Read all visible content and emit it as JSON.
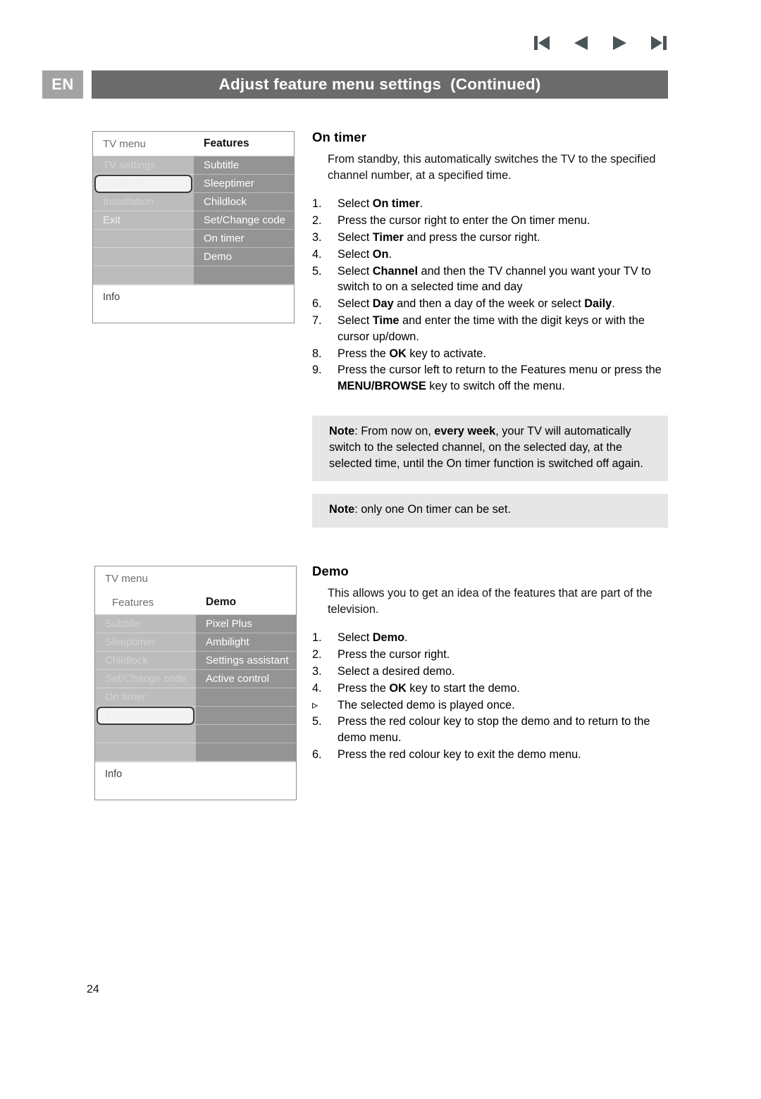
{
  "header": {
    "language_badge": "EN",
    "title": "Adjust feature menu settings  (Continued)"
  },
  "nav": {
    "first_label": "first-page",
    "prev_label": "previous-page",
    "next_label": "next-page",
    "last_label": "last-page",
    "icon_color": "#4a5557"
  },
  "page_number": "24",
  "colors": {
    "header_bar": "#6b6b6b",
    "badge": "#a3a3a3",
    "menu_left_column": "#bcbcbc",
    "menu_right_column": "#949494",
    "note_background": "#e6e6e6"
  },
  "tv_menu_1": {
    "header_left": "TV menu",
    "header_right": "Features",
    "left_column": [
      {
        "label": "TV settings",
        "state": "dim"
      },
      {
        "label": "Features",
        "state": "selected"
      },
      {
        "label": "Installation",
        "state": "dim"
      },
      {
        "label": "Exit",
        "state": "normal"
      },
      {
        "label": "",
        "state": "empty"
      },
      {
        "label": "",
        "state": "empty"
      },
      {
        "label": "",
        "state": "empty"
      }
    ],
    "right_column": [
      {
        "label": "Subtitle",
        "state": "normal"
      },
      {
        "label": "Sleeptimer",
        "state": "normal"
      },
      {
        "label": "Childlock",
        "state": "normal"
      },
      {
        "label": "Set/Change code",
        "state": "normal"
      },
      {
        "label": "On timer",
        "state": "normal"
      },
      {
        "label": "Demo",
        "state": "normal"
      },
      {
        "label": "",
        "state": "empty"
      }
    ],
    "footer": "Info"
  },
  "tv_menu_2": {
    "header_top": "TV menu",
    "header_left": "Features",
    "header_right": "Demo",
    "left_column": [
      {
        "label": "Subtitle",
        "state": "dim"
      },
      {
        "label": "Sleeptimer",
        "state": "dim"
      },
      {
        "label": "Childlock",
        "state": "dim"
      },
      {
        "label": "Set/Change code",
        "state": "dim"
      },
      {
        "label": "On timer",
        "state": "dim"
      },
      {
        "label": "Demo",
        "state": "selected"
      },
      {
        "label": "",
        "state": "empty"
      },
      {
        "label": "",
        "state": "empty"
      }
    ],
    "right_column": [
      {
        "label": "Pixel Plus",
        "state": "normal"
      },
      {
        "label": "Ambilight",
        "state": "normal"
      },
      {
        "label": "Settings assistant",
        "state": "normal"
      },
      {
        "label": "Active control",
        "state": "normal"
      },
      {
        "label": "",
        "state": "empty"
      },
      {
        "label": "",
        "state": "empty"
      },
      {
        "label": "",
        "state": "empty"
      },
      {
        "label": "",
        "state": "empty"
      }
    ],
    "footer": "Info"
  },
  "on_timer": {
    "title": "On timer",
    "intro": "From standby, this automatically switches the TV to the specified channel number, at a specified time.",
    "steps": [
      {
        "num": "1.",
        "html": "Select <span class=\"b\">On timer</span>."
      },
      {
        "num": "2.",
        "html": "Press the cursor right to enter the On timer menu."
      },
      {
        "num": "3.",
        "html": "Select <span class=\"b\">Timer</span> and press the cursor right."
      },
      {
        "num": "4.",
        "html": "Select <span class=\"b\">On</span>."
      },
      {
        "num": "5.",
        "html": "Select <span class=\"b\">Channel</span> and then the TV channel you want your TV to switch to on a selected time and day"
      },
      {
        "num": "6.",
        "html": "Select <span class=\"b\">Day</span> and then a day of the week or select <span class=\"b\">Daily</span>."
      },
      {
        "num": "7.",
        "html": "Select <span class=\"b\">Time</span> and enter the time with the digit keys or with the cursor up/down."
      },
      {
        "num": "8.",
        "html": "Press the <span class=\"b\">OK</span> key to activate."
      },
      {
        "num": "9.",
        "html": "Press the cursor left to return to the Features menu or press the <span class=\"b\">MENU/BROWSE</span> key to switch off the menu."
      }
    ],
    "note_1_html": "<span class=\"b\">Note</span>: From now on, <span class=\"b\">every week</span>, your TV will automatically switch to the selected channel, on the selected day, at the selected time, until the On timer function is switched off again.",
    "note_2_html": "<span class=\"b\">Note</span>: only one On timer can be set."
  },
  "demo": {
    "title": "Demo",
    "intro": "This allows you to get an idea of the features that are part of the television.",
    "steps": [
      {
        "num": "1.",
        "html": "Select <span class=\"b\">Demo</span>."
      },
      {
        "num": "2.",
        "html": "Press the cursor right."
      },
      {
        "num": "3.",
        "html": "Select a desired demo."
      },
      {
        "num": "4.",
        "html": "Press the <span class=\"b\">OK</span> key to start the demo."
      },
      {
        "num": "▹",
        "html": "The selected demo is played once."
      },
      {
        "num": "5.",
        "html": "Press the red colour key to stop the demo and to return to the demo menu."
      },
      {
        "num": "6.",
        "html": "Press the red colour key to exit the demo menu."
      }
    ]
  }
}
